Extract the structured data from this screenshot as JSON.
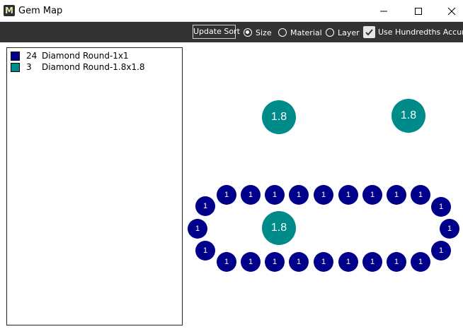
{
  "window": {
    "title": "Gem Map",
    "app_icon_letter": "M",
    "controls": [
      "minimize-icon",
      "maximize-icon",
      "close-icon"
    ]
  },
  "toolbar": {
    "update_sort_label": "Update Sort",
    "sort_options": [
      {
        "label": "Size",
        "selected": true
      },
      {
        "label": "Material",
        "selected": false
      },
      {
        "label": "Layer",
        "selected": false
      }
    ],
    "hundredths": {
      "label": "Use Hundredths Accuracy",
      "checked": true
    }
  },
  "legend": [
    {
      "count": "24",
      "name": "Diamond Round-1x1",
      "color": "#00008b"
    },
    {
      "count": "3",
      "name": "Diamond Round-1.8x1.8",
      "color": "#008b8b"
    }
  ],
  "gem_map": {
    "small_label": "1",
    "big_label": "1.8",
    "small_color": "#00008b",
    "big_color": "#008b8b",
    "small_count": 24,
    "big_count": 3
  }
}
